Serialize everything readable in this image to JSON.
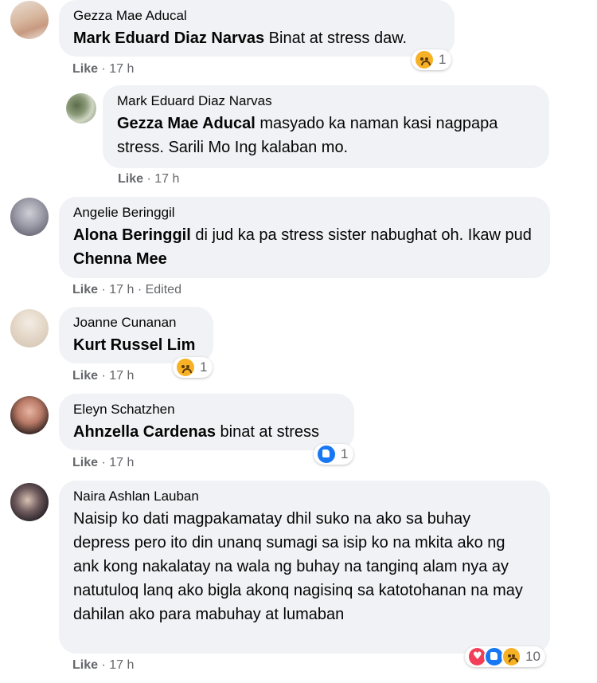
{
  "comments": [
    {
      "author": "Gezza Mae Aducal",
      "mention": "Mark Eduard Diaz Narvas",
      "text": " Binat at stress daw.",
      "meta": {
        "like": "Like",
        "time": "17 h"
      },
      "reactions": {
        "icons": [
          "sad-emoji"
        ],
        "count": "1"
      }
    },
    {
      "author": "Mark Eduard Diaz Narvas",
      "mention": "Gezza Mae Aducal",
      "text": " masyado ka naman kasi nagpapa stress. Sarili Mo Ing kalaban mo.",
      "meta": {
        "like": "Like",
        "time": "17 h"
      }
    },
    {
      "author": "Angelie Beringgil",
      "mention": "Alona Beringgil",
      "text": " di jud ka pa stress sister nabughat oh. Ikaw pud ",
      "mention2": "Chenna Mee",
      "meta": {
        "like": "Like",
        "time": "17 h",
        "edited": "Edited"
      }
    },
    {
      "author": "Joanne Cunanan",
      "mention": "Kurt Russel Lim",
      "text": "",
      "meta": {
        "like": "Like",
        "time": "17 h"
      },
      "reactions": {
        "icons": [
          "sad-emoji"
        ],
        "count": "1"
      }
    },
    {
      "author": "Eleyn Schatzhen",
      "mention": "Ahnzella Cardenas",
      "text": " binat at stress",
      "meta": {
        "like": "Like",
        "time": "17 h"
      },
      "reactions": {
        "icons": [
          "like-emoji"
        ],
        "count": "1"
      }
    },
    {
      "author": "Naira Ashlan Lauban",
      "text": "Naisip ko dati magpakamatay dhil suko na ako sa buhay depress pero ito din unanq sumagi sa isip ko na mkita ako ng ank kong nakalatay na wala ng buhay na tanginq alam nya ay natutuloq lanq ako bigla akonq nagisinq sa katotohanan na may dahilan ako para mabuhay at lumaban",
      "meta": {
        "like": "Like",
        "time": "17 h"
      },
      "reactions": {
        "icons": [
          "love-emoji",
          "like-emoji",
          "sad-emoji"
        ],
        "count": "10"
      }
    }
  ],
  "separator": " · ",
  "colors": {
    "bubble": "#f0f2f5",
    "meta": "#65676b",
    "like": "#1877f2",
    "love": "#f33e58",
    "sad": "#f7b125"
  }
}
